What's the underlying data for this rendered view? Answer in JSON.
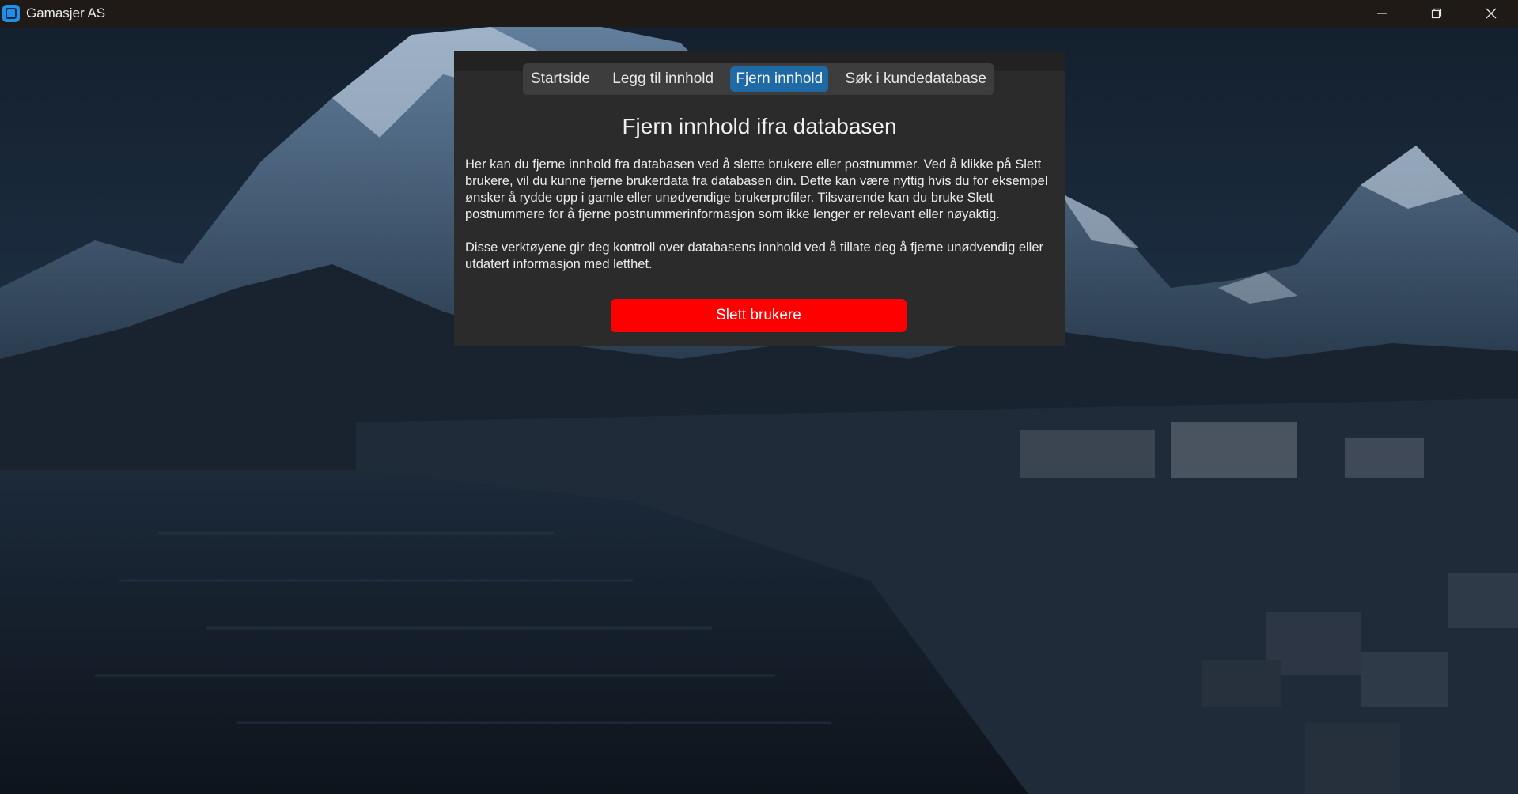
{
  "window": {
    "title": "Gamasjer AS",
    "icon": "app-logo-icon",
    "controls": {
      "minimize_icon": "minimize-icon",
      "maximize_icon": "restore-icon",
      "close_icon": "close-icon"
    }
  },
  "nav": {
    "tabs": [
      {
        "label": "Startside",
        "active": false
      },
      {
        "label": "Legg til innhold",
        "active": false
      },
      {
        "label": "Fjern innhold",
        "active": true
      },
      {
        "label": "Søk i kundedatabase",
        "active": false
      }
    ]
  },
  "main": {
    "title": "Fjern innhold ifra databasen",
    "paragraph_1": "Her kan du fjerne innhold fra databasen ved å slette brukere eller postnummer. Ved å klikke på Slett brukere, vil du kunne fjerne brukerdata fra databasen din. Dette kan være nyttig hvis du for eksempel ønsker å rydde opp i gamle eller unødvendige brukerprofiler. Tilsvarende kan du bruke Slett postnummere for å fjerne postnummerinformasjon som ikke lenger er relevant eller nøyaktig.",
    "paragraph_2": "Disse verktøyene gir deg kontroll over databasens innhold ved å tillate deg å fjerne unødvendig eller utdatert informasjon med letthet.",
    "delete_users_label": "Slett brukere"
  },
  "colors": {
    "titlebar": "#201a16",
    "panel": "#2b2b2b",
    "tabbar": "#3d3d3d",
    "active_tab": "#1f6aa5",
    "danger_button": "#ff0000"
  }
}
